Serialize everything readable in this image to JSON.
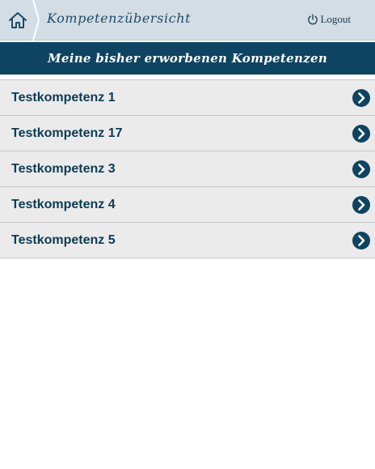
{
  "header": {
    "title": "Kompetenzübersicht",
    "home_icon": "home-icon",
    "logout_label": "Logout",
    "logout_icon": "power-icon"
  },
  "section": {
    "title": "Meine bisher erworbenen Kompetenzen"
  },
  "competencies": [
    {
      "label": "Testkompetenz 1"
    },
    {
      "label": "Testkompetenz 17"
    },
    {
      "label": "Testkompetenz 3"
    },
    {
      "label": "Testkompetenz 4"
    },
    {
      "label": "Testkompetenz 5"
    }
  ],
  "colors": {
    "topbar_bg": "#d3dde6",
    "accent": "#0e4461",
    "item_bg": "#ebebeb",
    "item_text": "#0d3c55"
  }
}
